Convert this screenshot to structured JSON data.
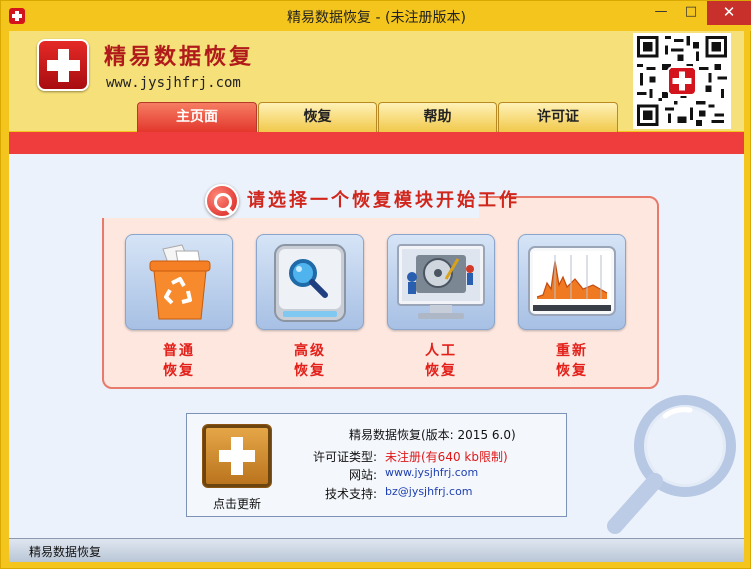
{
  "window": {
    "title": "精易数据恢复  - (未注册版本)",
    "min": "—",
    "max": "□",
    "close": "✕"
  },
  "brand": {
    "name": "精易数据恢复",
    "url": "www.jysjhfrj.com"
  },
  "tabs": [
    {
      "label": "主页面",
      "active": true
    },
    {
      "label": "恢复",
      "active": false
    },
    {
      "label": "帮助",
      "active": false
    },
    {
      "label": "许可证",
      "active": false
    }
  ],
  "panel": {
    "title": "请选择一个恢复模块开始工作",
    "modules": [
      {
        "label_line1": "普通",
        "label_line2": "恢复",
        "icon": "recycle-bin-icon"
      },
      {
        "label_line1": "高级",
        "label_line2": "恢复",
        "icon": "disk-search-icon"
      },
      {
        "label_line1": "人工",
        "label_line2": "恢复",
        "icon": "hard-drive-repair-icon"
      },
      {
        "label_line1": "重新",
        "label_line2": "恢复",
        "icon": "chart-scan-icon"
      }
    ]
  },
  "info": {
    "version": "精易数据恢复(版本: 2015 6.0)",
    "update_label": "点击更新",
    "license_key": "许可证类型:",
    "license_val": "未注册(有640 kb限制)",
    "site_key": "网站:",
    "site_val": "www.jysjhfrj.com",
    "support_key": "技术支持:",
    "support_val": "bz@jysjhfrj.com"
  },
  "status": {
    "text": "精易数据恢复"
  },
  "colors": {
    "frame": "#f4c51c",
    "accent_red": "#ef3d3e",
    "label_red": "#e3201a"
  }
}
